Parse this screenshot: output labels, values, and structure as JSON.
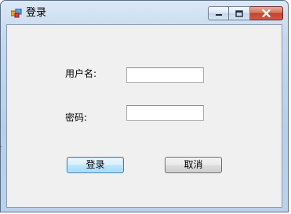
{
  "window": {
    "title": "登录",
    "icon": "app-form-icon",
    "caption": {
      "minimize_icon": "minimize-icon",
      "maximize_icon": "maximize-icon",
      "close_icon": "close-icon"
    }
  },
  "form": {
    "username_label": "用户名:",
    "username_value": "",
    "password_label": "密码:",
    "password_value": "",
    "login_button": "登录",
    "cancel_button": "取消"
  },
  "side_mark": "-"
}
